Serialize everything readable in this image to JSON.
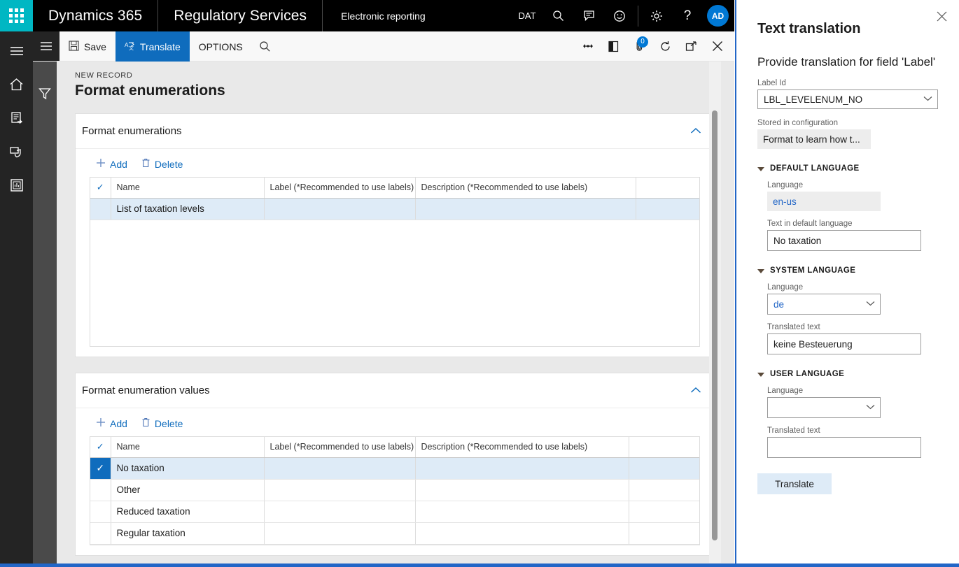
{
  "topbar": {
    "waffle_icon": "app-launcher-icon",
    "brand": "Dynamics 365",
    "area": "Regulatory Services",
    "module": "Electronic reporting",
    "company": "DAT",
    "icons": [
      "search-icon",
      "feedback-icon",
      "smiley-icon",
      "gear-icon",
      "help-icon"
    ],
    "avatar_initials": "AD"
  },
  "rail": {
    "items": [
      {
        "icon": "hamburger-icon",
        "name": "nav-expand"
      },
      {
        "icon": "home-icon",
        "name": "home"
      },
      {
        "icon": "workspaces-icon",
        "name": "workspaces"
      },
      {
        "icon": "modules-icon",
        "name": "modules"
      },
      {
        "icon": "report-icon",
        "name": "recent"
      }
    ],
    "filter_icon": "filter-funnel-icon"
  },
  "commandbar": {
    "save_label": "Save",
    "save_icon": "save-disk-icon",
    "translate_label": "Translate",
    "translate_icon": "translate-icon",
    "options_label": "OPTIONS",
    "search_icon": "search-icon",
    "right_icons": [
      {
        "name": "relationships-icon"
      },
      {
        "name": "office-export-icon"
      },
      {
        "name": "attachments-icon",
        "badge": "0"
      },
      {
        "name": "refresh-icon"
      },
      {
        "name": "popout-icon"
      },
      {
        "name": "close-icon"
      }
    ]
  },
  "workspace": {
    "breadcrumb": "NEW RECORD",
    "title": "Format enumerations"
  },
  "section1": {
    "title": "Format enumerations",
    "collapse_icon": "chevron-up-icon",
    "toolbar": {
      "add_label": "Add",
      "add_icon": "plus-icon",
      "delete_label": "Delete",
      "delete_icon": "trash-icon"
    },
    "columns": [
      "Name",
      "Label (*Recommended to use labels)",
      "Description (*Recommended to use labels)"
    ],
    "rows": [
      {
        "name": "List of taxation levels",
        "label": "",
        "description": "",
        "selected": true,
        "checked": false
      }
    ]
  },
  "section2": {
    "title": "Format enumeration values",
    "collapse_icon": "chevron-up-icon",
    "toolbar": {
      "add_label": "Add",
      "add_icon": "plus-icon",
      "delete_label": "Delete",
      "delete_icon": "trash-icon"
    },
    "columns": [
      "Name",
      "Label (*Recommended to use labels)",
      "Description (*Recommended to use labels)"
    ],
    "rows": [
      {
        "name": "No taxation",
        "label": "",
        "description": "",
        "selected": true,
        "checked": true
      },
      {
        "name": "Other",
        "label": "",
        "description": "",
        "selected": false,
        "checked": false
      },
      {
        "name": "Reduced taxation",
        "label": "",
        "description": "",
        "selected": false,
        "checked": false
      },
      {
        "name": "Regular taxation",
        "label": "",
        "description": "",
        "selected": false,
        "checked": false
      }
    ]
  },
  "panel": {
    "close_icon": "close-icon",
    "title": "Text translation",
    "subtitle": "Provide translation for field 'Label'",
    "label_id": {
      "label": "Label Id",
      "value": "LBL_LEVELENUM_NO",
      "dropdown_icon": "chevron-down-icon"
    },
    "stored_in_configuration": {
      "label": "Stored in configuration",
      "value": "Format to learn how t..."
    },
    "default_language": {
      "section_title": "DEFAULT LANGUAGE",
      "language_label": "Language",
      "language_value": "en-us",
      "text_label": "Text in default language",
      "text_value": "No taxation"
    },
    "system_language": {
      "section_title": "SYSTEM LANGUAGE",
      "language_label": "Language",
      "language_value": "de",
      "text_label": "Translated text",
      "text_value": "keine Besteuerung",
      "dropdown_icon": "chevron-down-icon"
    },
    "user_language": {
      "section_title": "USER LANGUAGE",
      "language_label": "Language",
      "language_value": "",
      "text_label": "Translated text",
      "text_value": "",
      "dropdown_icon": "chevron-down-icon"
    },
    "translate_button": "Translate"
  },
  "colors": {
    "accent": "#0F6CBD",
    "teal": "#00B7C3",
    "panel_border": "#2266C7",
    "selected_row": "#DEEBF7",
    "workspace_bg": "#E9E9E9"
  }
}
